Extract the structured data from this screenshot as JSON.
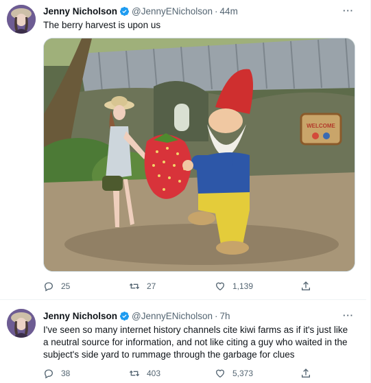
{
  "tweets": [
    {
      "author_name": "Jenny Nicholson",
      "handle": "@JennyENicholson",
      "separator": "·",
      "time": "44m",
      "text": "The berry harvest is upon us",
      "media_sign_text": "WELCOME",
      "replies": "25",
      "retweets": "27",
      "likes": "1,139",
      "more_label": "···"
    },
    {
      "author_name": "Jenny Nicholson",
      "handle": "@JennyENicholson",
      "separator": "·",
      "time": "7h",
      "text": "I've seen so many internet history channels cite kiwi farms as if it's just like a neutral source for information, and not like citing a guy who waited in the subject's side yard to rummage through the garbage for clues",
      "replies": "38",
      "retweets": "403",
      "likes": "5,373",
      "more_label": "···"
    }
  ],
  "colors": {
    "verified": "#1d9bf0",
    "secondary_text": "#536471",
    "primary_text": "#0f1419",
    "divider": "#eff3f4"
  },
  "icons": [
    "avatar",
    "verified-badge-icon",
    "more-icon",
    "reply-icon",
    "retweet-icon",
    "like-icon",
    "share-icon"
  ]
}
